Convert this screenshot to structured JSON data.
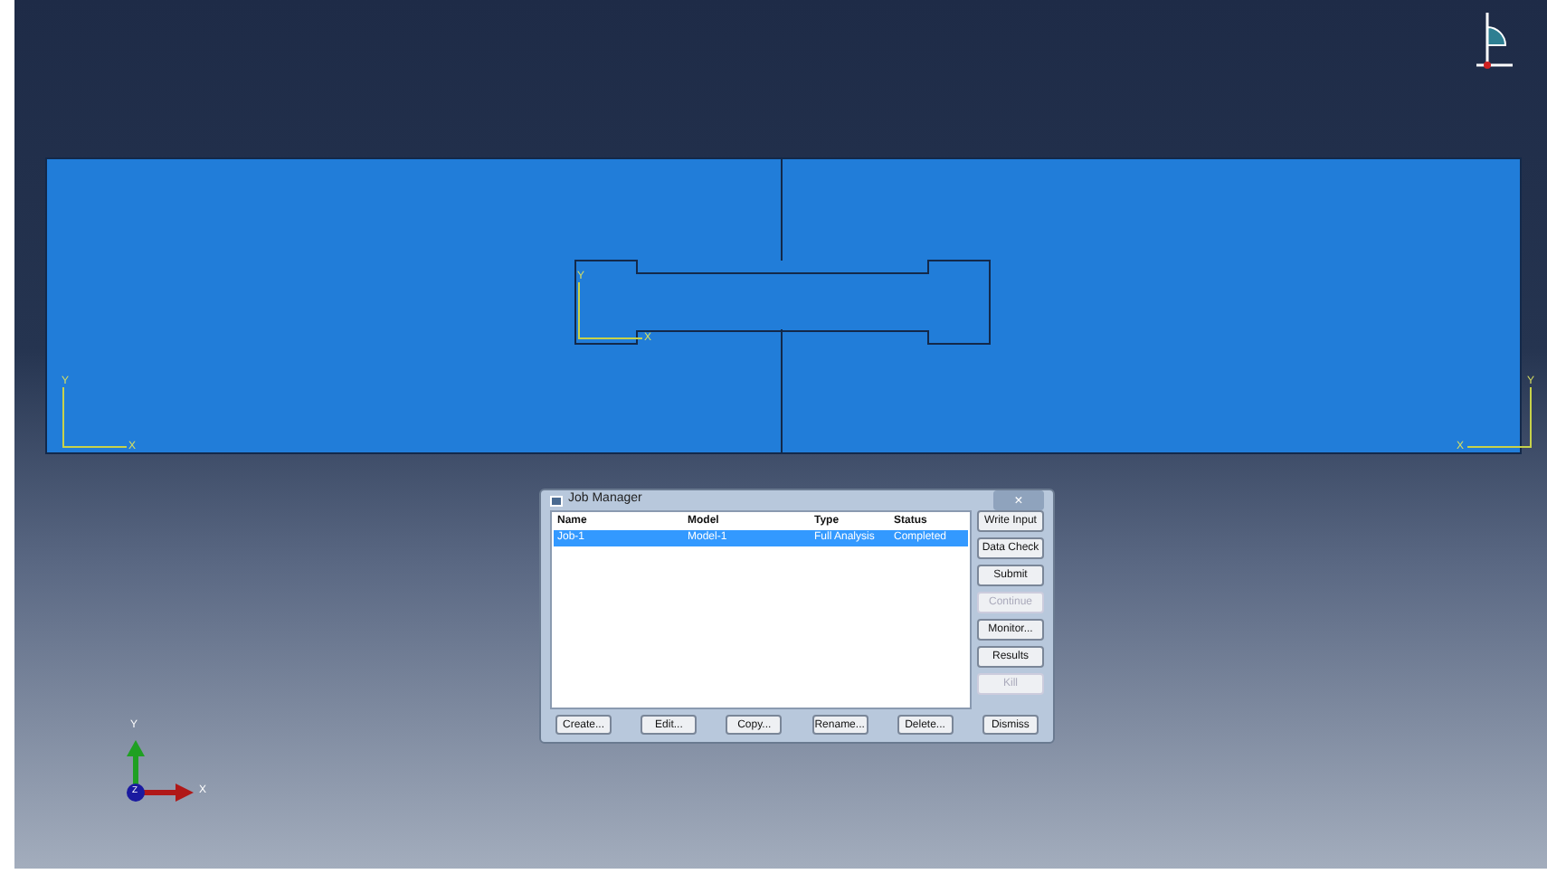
{
  "viewport": {
    "csys_marks": [
      {
        "y": "Y",
        "x": "X",
        "kind": "left"
      },
      {
        "y": "Y",
        "x": "X",
        "kind": "part"
      },
      {
        "y": "Y",
        "x": "X",
        "kind": "right"
      }
    ],
    "triad": {
      "y": "Y",
      "x": "X",
      "z": "Z"
    }
  },
  "job_manager": {
    "title": "Job Manager",
    "close": "×",
    "columns": [
      "Name",
      "Model",
      "Type",
      "Status"
    ],
    "rows": [
      {
        "cells": [
          "Job-1",
          "Model-1",
          "Full Analysis",
          "Completed"
        ],
        "selected": true
      }
    ],
    "side_buttons": [
      {
        "label": "Write Input",
        "disabled": false
      },
      {
        "label": "Data Check",
        "disabled": false
      },
      {
        "label": "Submit",
        "disabled": false
      },
      {
        "label": "Continue",
        "disabled": true
      },
      {
        "label": "Monitor...",
        "disabled": false
      },
      {
        "label": "Results",
        "disabled": false
      },
      {
        "label": "Kill",
        "disabled": true
      }
    ],
    "bottom_buttons": [
      "Create...",
      "Edit...",
      "Copy...",
      "Rename...",
      "Delete...",
      "Dismiss"
    ]
  }
}
